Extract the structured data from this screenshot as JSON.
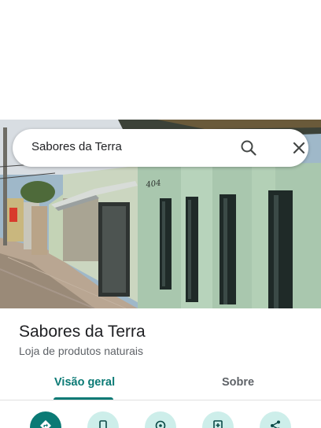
{
  "search": {
    "query": "Sabores da Terra"
  },
  "place": {
    "name": "Sabores da Terra",
    "category": "Loja de produtos naturais",
    "building_number": "404"
  },
  "tabs": [
    {
      "label": "Visão geral",
      "selected": true
    },
    {
      "label": "Sobre",
      "selected": false
    }
  ],
  "actions": [
    {
      "icon": "directions-icon"
    },
    {
      "icon": "phone-icon"
    },
    {
      "icon": "location-icon"
    },
    {
      "icon": "save-icon"
    },
    {
      "icon": "share-icon"
    }
  ],
  "colors": {
    "accent": "#0b7a75",
    "accent_light": "#cdeeea",
    "text_primary": "#202124",
    "text_secondary": "#5f6368"
  }
}
